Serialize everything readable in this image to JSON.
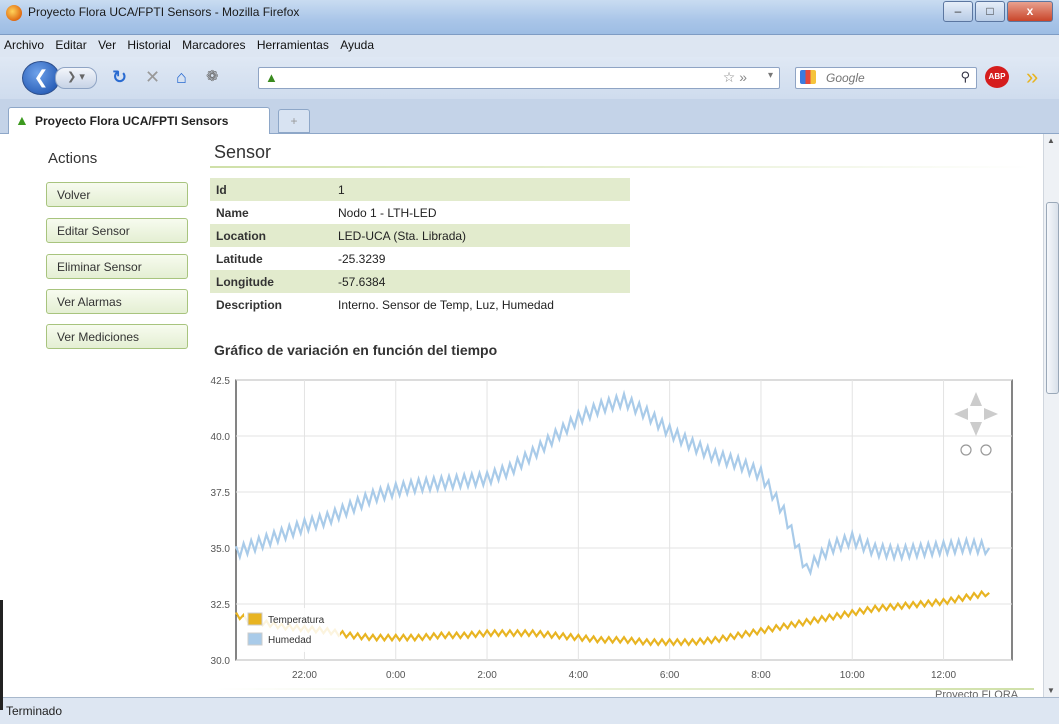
{
  "window": {
    "title": "Proyecto Flora UCA/FPTI Sensors - Mozilla Firefox",
    "min": "–",
    "max": "□",
    "close": "x"
  },
  "menu": [
    "Archivo",
    "Editar",
    "Ver",
    "Historial",
    "Marcadores",
    "Herramientas",
    "Ayuda"
  ],
  "search": {
    "placeholder": "Google"
  },
  "tab": {
    "label": "Proyecto Flora UCA/FPTI Sensors",
    "new": "+"
  },
  "sidebar": {
    "title": "Actions",
    "buttons": [
      "Volver",
      "Editar Sensor",
      "Eliminar Sensor",
      "Ver Alarmas",
      "Ver Mediciones"
    ]
  },
  "sensor": {
    "heading": "Sensor",
    "fields": [
      {
        "key": "Id",
        "value": "1"
      },
      {
        "key": "Name",
        "value": "Nodo 1 - LTH-LED"
      },
      {
        "key": "Location",
        "value": "LED-UCA (Sta. Librada)"
      },
      {
        "key": "Latitude",
        "value": "-25.3239"
      },
      {
        "key": "Longitude",
        "value": "-57.6384"
      },
      {
        "key": "Description",
        "value": "Interno. Sensor de Temp, Luz, Humedad"
      }
    ]
  },
  "graph_title": "Gráfico de variación en función del tiempo",
  "chart_data": {
    "type": "line",
    "ylim": [
      30.0,
      42.5
    ],
    "yticks": [
      "30.0",
      "32.5",
      "35.0",
      "37.5",
      "40.0",
      "42.5"
    ],
    "xlim": [
      20.5,
      13.0
    ],
    "xticks": [
      "22:00",
      "0:00",
      "2:00",
      "4:00",
      "6:00",
      "8:00",
      "10:00",
      "12:00"
    ],
    "grid": true,
    "legend": "bottom-left",
    "series": [
      {
        "name": "Temperatura",
        "color": "#e8b422",
        "x": [
          20.5,
          21.0,
          21.5,
          22.0,
          22.5,
          23.0,
          23.5,
          24.0,
          24.5,
          25.0,
          25.5,
          26.0,
          26.5,
          27.0,
          27.5,
          28.0,
          28.5,
          29.0,
          29.5,
          30.0,
          30.5,
          31.0,
          31.5,
          32.0,
          32.5,
          33.0,
          33.5,
          34.0,
          34.5,
          35.0,
          35.5,
          36.0,
          36.5,
          37.0
        ],
        "y": [
          32.0,
          31.7,
          31.5,
          31.4,
          31.3,
          31.1,
          31.0,
          31.0,
          31.0,
          31.1,
          31.1,
          31.2,
          31.2,
          31.2,
          31.1,
          31.0,
          30.9,
          30.9,
          30.8,
          30.8,
          30.8,
          30.9,
          31.1,
          31.3,
          31.5,
          31.7,
          31.9,
          32.1,
          32.3,
          32.4,
          32.5,
          32.6,
          32.8,
          33.0
        ]
      },
      {
        "name": "Humedad",
        "color": "#a9cbe9",
        "x": [
          20.5,
          21.0,
          21.5,
          22.0,
          22.5,
          23.0,
          23.5,
          24.0,
          24.5,
          25.0,
          25.5,
          26.0,
          26.5,
          27.0,
          27.5,
          28.0,
          28.5,
          29.0,
          29.5,
          30.0,
          30.5,
          31.0,
          31.5,
          32.0,
          32.5,
          33.0,
          33.5,
          34.0,
          34.5,
          35.0,
          35.5,
          36.0,
          36.5,
          37.0
        ],
        "y": [
          34.8,
          35.2,
          35.6,
          36.0,
          36.3,
          36.8,
          37.3,
          37.6,
          37.8,
          37.9,
          38.0,
          38.1,
          38.5,
          39.2,
          40.0,
          40.8,
          41.3,
          41.6,
          41.0,
          40.2,
          39.6,
          39.1,
          38.8,
          38.3,
          36.6,
          34.0,
          35.0,
          35.4,
          34.9,
          34.8,
          34.9,
          35.0,
          35.1,
          35.0
        ]
      }
    ]
  },
  "footer": "Proyecto FLORA",
  "status": "Terminado"
}
